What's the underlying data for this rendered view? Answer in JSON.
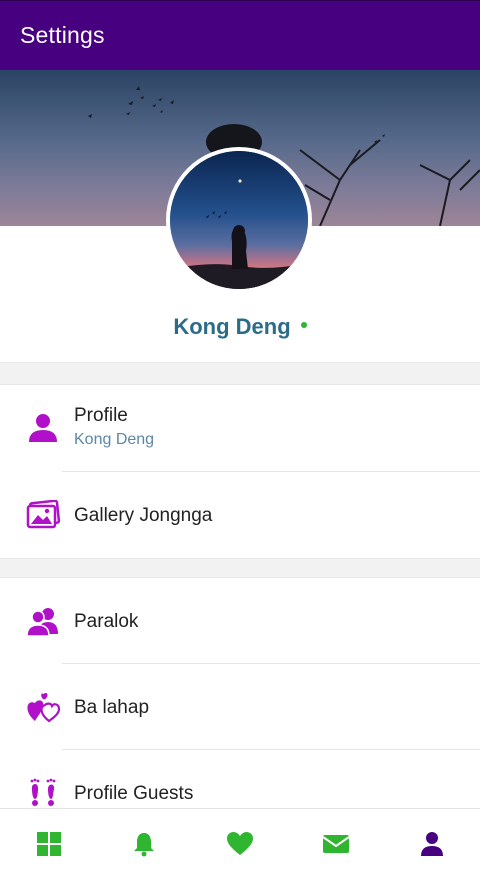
{
  "app": {
    "title": "Settings"
  },
  "profile": {
    "name": "Kong Deng",
    "status": "online"
  },
  "sections": [
    {
      "items": [
        {
          "id": "profile",
          "label": "Profile",
          "sub": "Kong Deng",
          "icon": "person-icon"
        },
        {
          "id": "gallery",
          "label": "Gallery Jongnga",
          "icon": "photos-icon"
        }
      ]
    },
    {
      "items": [
        {
          "id": "paralok",
          "label": "Paralok",
          "icon": "friends-icon"
        },
        {
          "id": "ba-lahap",
          "label": "Ba lahap",
          "icon": "hearts-icon"
        },
        {
          "id": "profile-guests",
          "label": "Profile Guests",
          "icon": "footprints-icon"
        }
      ]
    }
  ],
  "bottom_nav": [
    {
      "id": "home",
      "icon": "grid-icon",
      "color": "#2fb52f"
    },
    {
      "id": "notifications",
      "icon": "bell-icon",
      "color": "#2fb52f"
    },
    {
      "id": "likes",
      "icon": "heart-icon",
      "color": "#2fb52f"
    },
    {
      "id": "messages",
      "icon": "mail-icon",
      "color": "#2fb52f"
    },
    {
      "id": "account",
      "icon": "person-icon",
      "color": "#470080",
      "active": true
    }
  ],
  "colors": {
    "appbar": "#470080",
    "icon_accent": "#b010c8",
    "name_text": "#2b6c89",
    "sub_text": "#5b87a8",
    "online": "#2fb52f",
    "nav_inactive": "#2fb52f",
    "nav_active": "#470080"
  }
}
